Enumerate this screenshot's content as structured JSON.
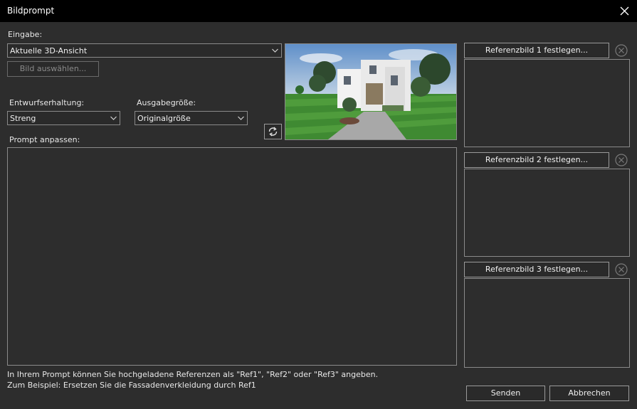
{
  "window": {
    "title": "Bildprompt"
  },
  "input_section": {
    "label": "Eingabe:",
    "select_value": "Aktuelle 3D-Ansicht",
    "choose_image_button": "Bild auswählen..."
  },
  "design_preservation": {
    "label": "Entwurfserhaltung:",
    "value": "Streng"
  },
  "output_size": {
    "label": "Ausgabegröße:",
    "value": "Originalgröße"
  },
  "prompt": {
    "label": "Prompt anpassen:",
    "value": ""
  },
  "references": [
    {
      "button": "Referenzbild 1 festlegen..."
    },
    {
      "button": "Referenzbild 2 festlegen..."
    },
    {
      "button": "Referenzbild 3 festlegen..."
    }
  ],
  "hint": {
    "line1": "In Ihrem Prompt können Sie hochgeladene Referenzen als \"Ref1\", \"Ref2\" oder \"Ref3\" angeben.",
    "line2": "Zum Beispiel: Ersetzen Sie die Fassadenverkleidung durch Ref1"
  },
  "buttons": {
    "send": "Senden",
    "cancel": "Abbrechen"
  },
  "icons": {
    "close": "close-icon",
    "refresh": "refresh-icon",
    "remove": "remove-circle-icon",
    "chevron": "chevron-down-icon"
  },
  "colors": {
    "background": "#2d2d2d",
    "titlebar": "#000000",
    "border": "#8a8a8a",
    "text": "#e6e6e6"
  }
}
